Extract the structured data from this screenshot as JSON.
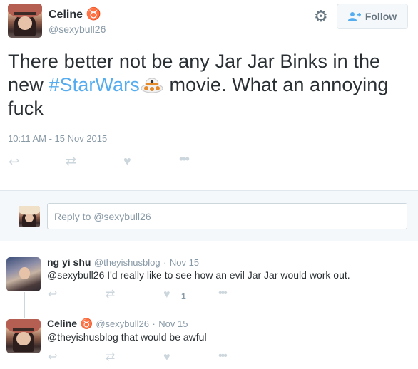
{
  "tweet": {
    "author_name": "Celine",
    "author_symbol": "♉",
    "author_handle": "@sexybull26",
    "text_part1": "There better not be any Jar Jar Binks in the new ",
    "hashtag": "#StarWars",
    "text_part2": " movie. What an annoying fuck",
    "timestamp": "10:11 AM - 15 Nov 2015",
    "actions": {
      "reply_icon": "reply-icon",
      "retweet_icon": "retweet-icon",
      "like_icon": "heart-icon",
      "more_icon": "more-icon"
    }
  },
  "header": {
    "follow_label": "Follow",
    "gear_icon": "gear-icon",
    "follow_icon": "add-user-icon"
  },
  "reply_box": {
    "placeholder": "Reply to @sexybull26"
  },
  "replies": [
    {
      "name": "ng yi shu",
      "handle": "@theyishusblog",
      "separator": "·",
      "date": "Nov 15",
      "text": "@sexybull26 I'd really like to see how an evil Jar Jar would work out.",
      "like_count": "1"
    },
    {
      "name": "Celine",
      "symbol": "♉",
      "handle": "@sexybull26",
      "separator": "·",
      "date": "Nov 15",
      "text": "@theyishusblog that would be awful",
      "like_count": ""
    }
  ],
  "colors": {
    "link": "#55acee",
    "text": "#292f33",
    "muted": "#8899a6",
    "icon": "#ccd6dd"
  }
}
